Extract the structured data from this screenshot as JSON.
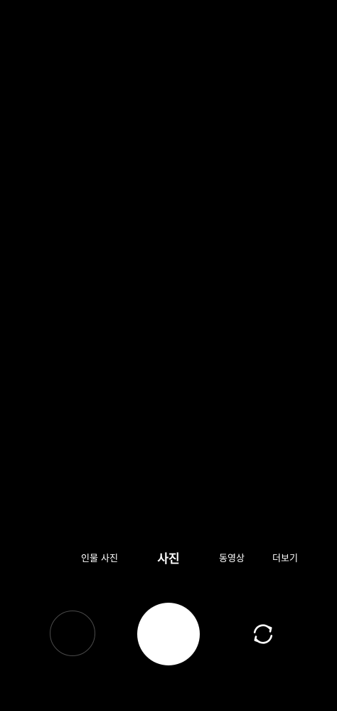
{
  "modes": {
    "portrait": "인물 사진",
    "photo": "사진",
    "video": "동영상",
    "more": "더보기",
    "active": "photo"
  },
  "icons": {
    "gallery": "gallery-thumbnail",
    "shutter": "shutter-button",
    "flip": "switch-camera-icon"
  },
  "colors": {
    "background": "#000000",
    "text": "#ffffff",
    "shutter": "#ffffff",
    "thumbnail_border": "#4a4a4a"
  }
}
